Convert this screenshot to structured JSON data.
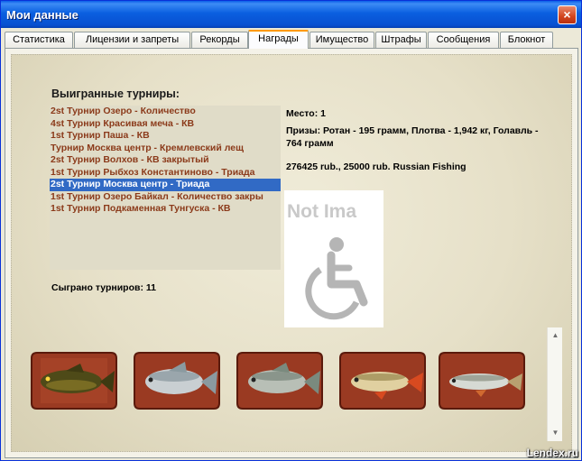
{
  "window": {
    "title": "Мои данные",
    "close_icon": "×"
  },
  "tabs": [
    {
      "label": "Статистика"
    },
    {
      "label": "Лицензии и запреты"
    },
    {
      "label": "Рекорды"
    },
    {
      "label": "Награды",
      "active": true
    },
    {
      "label": "Имущество"
    },
    {
      "label": "Штрафы"
    },
    {
      "label": "Сообщения"
    },
    {
      "label": "Блокнот"
    }
  ],
  "awards": {
    "heading": "Выигранные турниры:",
    "tournaments": [
      "2st Турнир Озеро - Количество",
      "4st Турнир Красивая меча - КВ",
      "1st Турнир Паша - КВ",
      "Турнир Москва центр - Кремлевский лещ",
      "2st Турнир Волхов - КВ закрытый",
      "1st Турнир Рыбхоз Константиново - Триада",
      "2st Турнир Москва центр - Триада",
      "1st Турнир Озеро Байкал - Количество закры",
      "1st Турнир Подкаменная Тунгуска - КВ"
    ],
    "selected_index": 6,
    "played_label": "Сыграно турниров: 11",
    "details": {
      "place": "Место: 1",
      "prizes": "Призы: Ротан - 195 грамм, Плотва - 1,942 кг, Голавль - 764 грамм",
      "reward": "276425 rub., 25000 rub. Russian Fishing"
    },
    "image_placeholder": "Not Ima",
    "fish_icons": [
      "tench-fish-icon",
      "bream-fish-icon",
      "silver-bream-fish-icon",
      "rudd-fish-icon",
      "chub-fish-icon"
    ],
    "scroll_up_icon": "▲",
    "scroll_down_icon": "▼"
  },
  "watermark": "Lendex.ru",
  "colors": {
    "title_bar": "#0a5fe0",
    "tournament_text": "#8b3a1a",
    "selection": "#316ac5",
    "plaque_wood": "#9a3a22"
  }
}
